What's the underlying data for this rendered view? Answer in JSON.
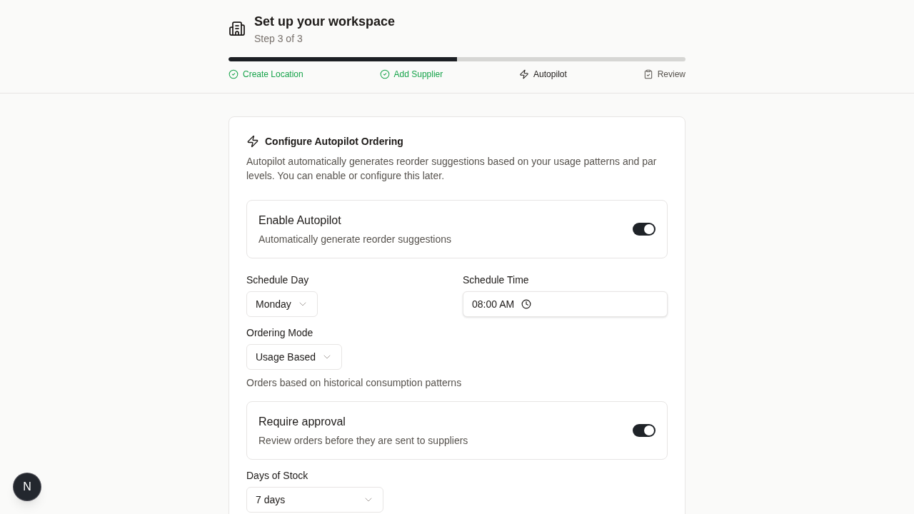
{
  "header": {
    "title": "Set up your workspace",
    "subtitle": "Step 3 of 3",
    "progress": {
      "level": 0.5
    }
  },
  "steps": [
    {
      "label": "Create Location",
      "completed": true,
      "current": false
    },
    {
      "label": "Add Supplier",
      "completed": true,
      "current": false
    },
    {
      "label": "Autopilot",
      "completed": false,
      "current": true
    },
    {
      "label": "Review",
      "completed": false,
      "current": false
    }
  ],
  "card": {
    "title": "Configure Autopilot Ordering",
    "description": "Autopilot automatically generates reorder suggestions based on your usage patterns and par levels. You can enable or configure this later.",
    "enable_autopilot": {
      "title": "Enable Autopilot",
      "description": "Automatically generate reorder suggestions",
      "on": true
    },
    "schedule": [
      {
        "label": "Schedule Day",
        "kind": "select",
        "value": "Monday"
      },
      {
        "label": "Schedule Time",
        "kind": "time",
        "value": "08:00 AM"
      }
    ],
    "ordering_mode": {
      "label": "Ordering Mode",
      "value": "Usage Based",
      "hint": "Orders based on historical consumption patterns"
    },
    "require_approval": {
      "title": "Require approval",
      "description": "Review orders before they are sent to suppliers",
      "on": true
    },
    "days_of_stock": {
      "label": "Days of Stock",
      "value": "7 days"
    }
  },
  "dev_badge": {
    "label": "N"
  }
}
